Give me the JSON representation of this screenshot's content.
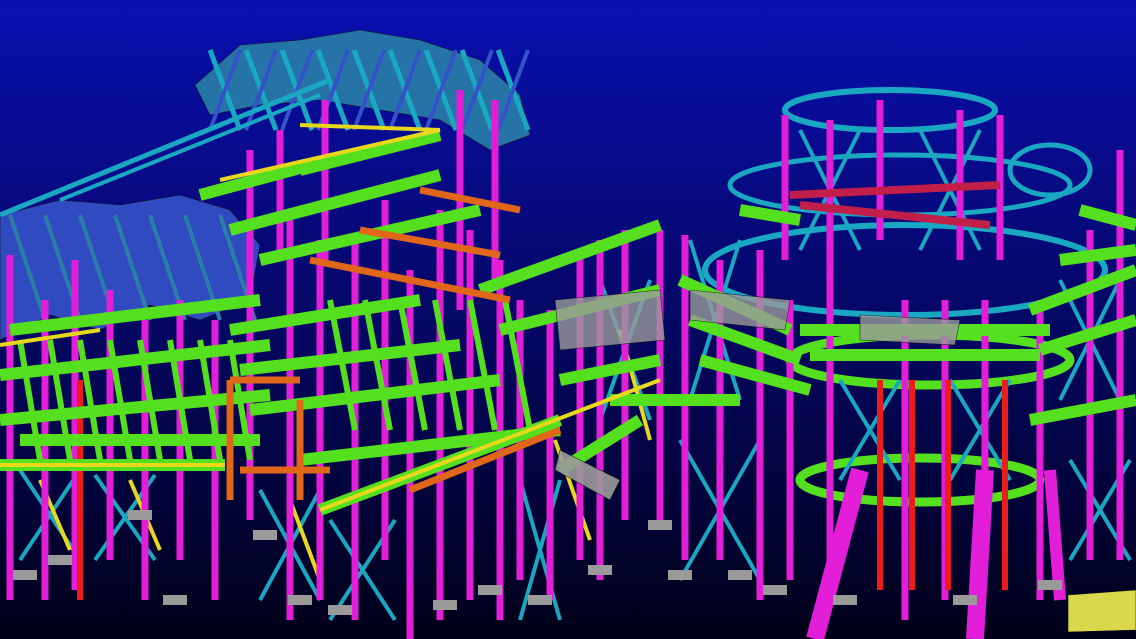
{
  "viewport": {
    "background_top": "#0a0fb0",
    "background_bottom": "#000018"
  },
  "palette": {
    "floor_beam": "#54e01e",
    "column": "#e21ed8",
    "bracing": "#1aa7c2",
    "roof_truss": "#2a7fa8",
    "roof_canopy": "#3553c9",
    "stair_stringer": "#e0661a",
    "rail": "#e8d81c",
    "main_girder": "#d4a01a",
    "red_support": "#ec1c1c",
    "grating": "#9a9a9a",
    "footing": "#d8d84a"
  }
}
